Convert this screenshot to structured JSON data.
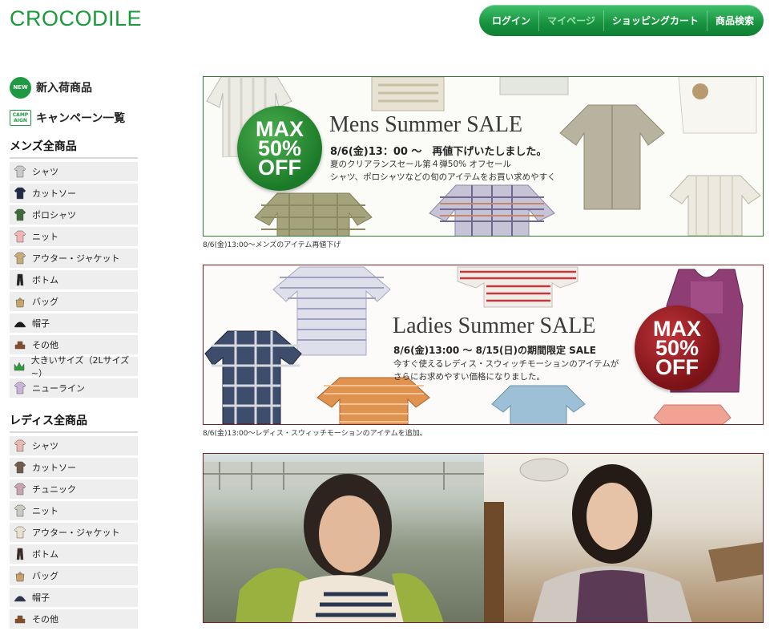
{
  "brand": {
    "logo": "CROCODILE",
    "color": "#1a9a3c"
  },
  "topnav": [
    "ログイン",
    "マイページ",
    "ショッピングカート",
    "商品検索"
  ],
  "sidebar": {
    "new_arrivals": {
      "icon_text": "NEW",
      "label": "新入荷商品"
    },
    "campaigns": {
      "icon_text": "CAMP AIGN",
      "label": "キャンペーン一覧"
    },
    "mens": {
      "title": "メンズ全商品",
      "items": [
        "シャツ",
        "カットソー",
        "ポロシャツ",
        "ニット",
        "アウター・ジャケット",
        "ボトム",
        "バッグ",
        "帽子",
        "その他",
        "大きいサイズ（2Lサイズ~）",
        "ニューライン"
      ]
    },
    "ladies": {
      "title": "レディス全商品",
      "items": [
        "シャツ",
        "カットソー",
        "チュニック",
        "ニット",
        "アウター・ジャケット",
        "ボトム",
        "バッグ",
        "帽子",
        "その他"
      ]
    }
  },
  "banners": {
    "mens": {
      "badge": [
        "MAX",
        "50%",
        "OFF"
      ],
      "title": "Mens Summer SALE",
      "sub": "8/6(金)13：00 ～　再値下げいたしました。",
      "text": [
        "夏のクリアランスセール第４弾50% オフセール",
        "シャツ、ポロシャツなどの旬のアイテムをお買い求めやすく"
      ],
      "caption": "8/6(金)13:00～メンズのアイテム再値下げ"
    },
    "ladies": {
      "badge": [
        "MAX",
        "50%",
        "OFF"
      ],
      "title": "Ladies Summer SALE",
      "sub": "8/6(金)13:00 ～ 8/15(日)の期間限定 SALE",
      "text": [
        "今すぐ使えるレディス・スウィッチモーションのアイテムが",
        "さらにお求めやすい価格になりました。"
      ],
      "caption": "8/6(金)13:00～レディス・スウィッチモーションのアイテムを追加。"
    }
  }
}
